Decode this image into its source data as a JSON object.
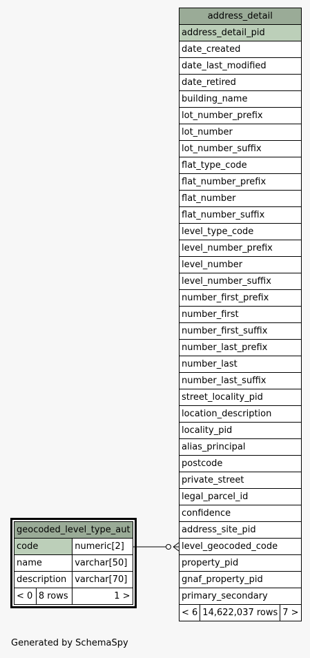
{
  "tables": {
    "address_detail": {
      "name": "address_detail",
      "primary_key": "address_detail_pid",
      "columns": [
        "date_created",
        "date_last_modified",
        "date_retired",
        "building_name",
        "lot_number_prefix",
        "lot_number",
        "lot_number_suffix",
        "flat_type_code",
        "flat_number_prefix",
        "flat_number",
        "flat_number_suffix",
        "level_type_code",
        "level_number_prefix",
        "level_number",
        "level_number_suffix",
        "number_first_prefix",
        "number_first",
        "number_first_suffix",
        "number_last_prefix",
        "number_last",
        "number_last_suffix",
        "street_locality_pid",
        "location_description",
        "locality_pid",
        "alias_principal",
        "postcode",
        "private_street",
        "legal_parcel_id",
        "confidence",
        "address_site_pid",
        "level_geocoded_code",
        "property_pid",
        "gnaf_property_pid",
        "primary_secondary"
      ],
      "footer": {
        "parents": "< 6",
        "rows": "14,622,037 rows",
        "children": "7 >"
      }
    },
    "geocoded_level_type_aut": {
      "name": "geocoded_level_type_aut",
      "columns": [
        {
          "name": "code",
          "type": "numeric[2]"
        },
        {
          "name": "name",
          "type": "varchar[50]"
        },
        {
          "name": "description",
          "type": "varchar[70]"
        }
      ],
      "footer": {
        "parents": "< 0",
        "rows": "8 rows",
        "children": "1 >"
      }
    }
  },
  "footer_text": "Generated by SchemaSpy"
}
